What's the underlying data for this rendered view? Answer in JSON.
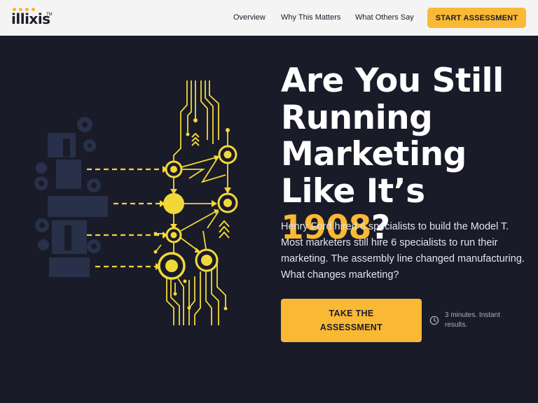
{
  "brand": {
    "logo_text": "illixis",
    "trademark": "TM",
    "accent_color": "#f9b934",
    "dark_color": "#191b28"
  },
  "nav": {
    "items": [
      {
        "label": "Overview"
      },
      {
        "label": "Why This Matters"
      },
      {
        "label": "What Others Say"
      }
    ],
    "cta_label": "START ASSESSMENT"
  },
  "hero": {
    "title_line1": "Are You Still",
    "title_line2": "Running",
    "title_line3": "Marketing",
    "title_line4_prefix": "Like It’s ",
    "title_highlight": "1908",
    "title_suffix": "?",
    "body": "Henry Ford hired 6 specialists to build the Model T. Most marketers still hire 6 specialists to run their marketing. The assembly line changed manufacturing. What changes marketing?",
    "cta_label": "TAKE THE ASSESSMENT",
    "time_note": "3 minutes. Instant results.",
    "time_icon": "clock-icon"
  },
  "illustration": {
    "name": "assembly-line-circuit-illustration",
    "line_color": "#f2d73a",
    "factory_color": "#2a3148"
  }
}
